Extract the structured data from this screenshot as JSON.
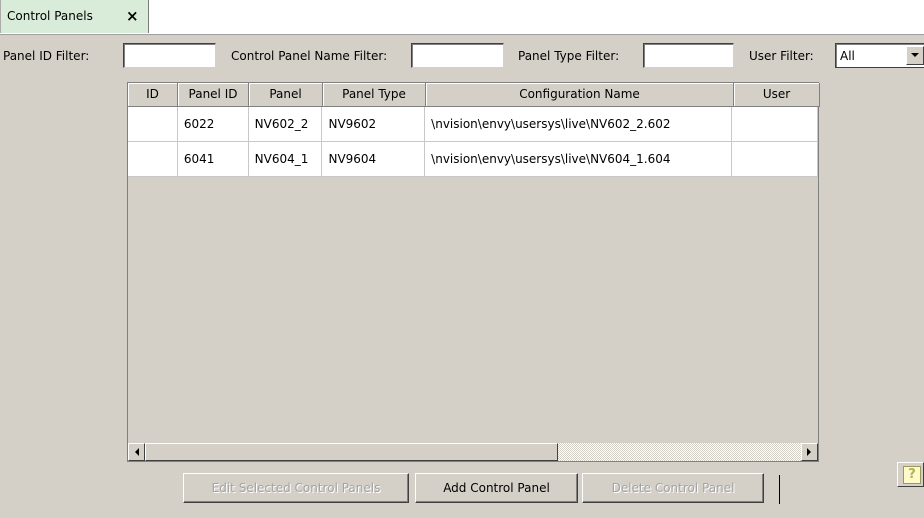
{
  "tabs": [
    {
      "label": "Control Panels",
      "close": "×"
    }
  ],
  "filters": {
    "panel_id": {
      "label": "Panel ID Filter:",
      "value": ""
    },
    "name": {
      "label": "Control Panel Name Filter:",
      "value": ""
    },
    "type": {
      "label": "Panel Type Filter:",
      "value": ""
    },
    "user": {
      "label": "User Filter:",
      "value": "All"
    }
  },
  "table": {
    "columns": [
      "ID",
      "Panel ID",
      "Panel",
      "Panel Type",
      "Configuration Name",
      "User"
    ],
    "rows": [
      [
        "",
        "6022",
        "NV602_2",
        "NV9602",
        "\\nvision\\envy\\usersys\\live\\NV602_2.602",
        ""
      ],
      [
        "",
        "6041",
        "NV604_1",
        "NV9604",
        "\\nvision\\envy\\usersys\\live\\NV604_1.604",
        ""
      ]
    ]
  },
  "buttons": {
    "edit": "Edit Selected Control Panels",
    "add": "Add Control Panel",
    "delete": "Delete Control Panel",
    "help": "?"
  },
  "icons": {
    "close": "close-icon",
    "dropdown": "chevron-down-icon",
    "scroll_left": "arrow-left-icon",
    "scroll_right": "arrow-right-icon",
    "help": "help-icon"
  }
}
